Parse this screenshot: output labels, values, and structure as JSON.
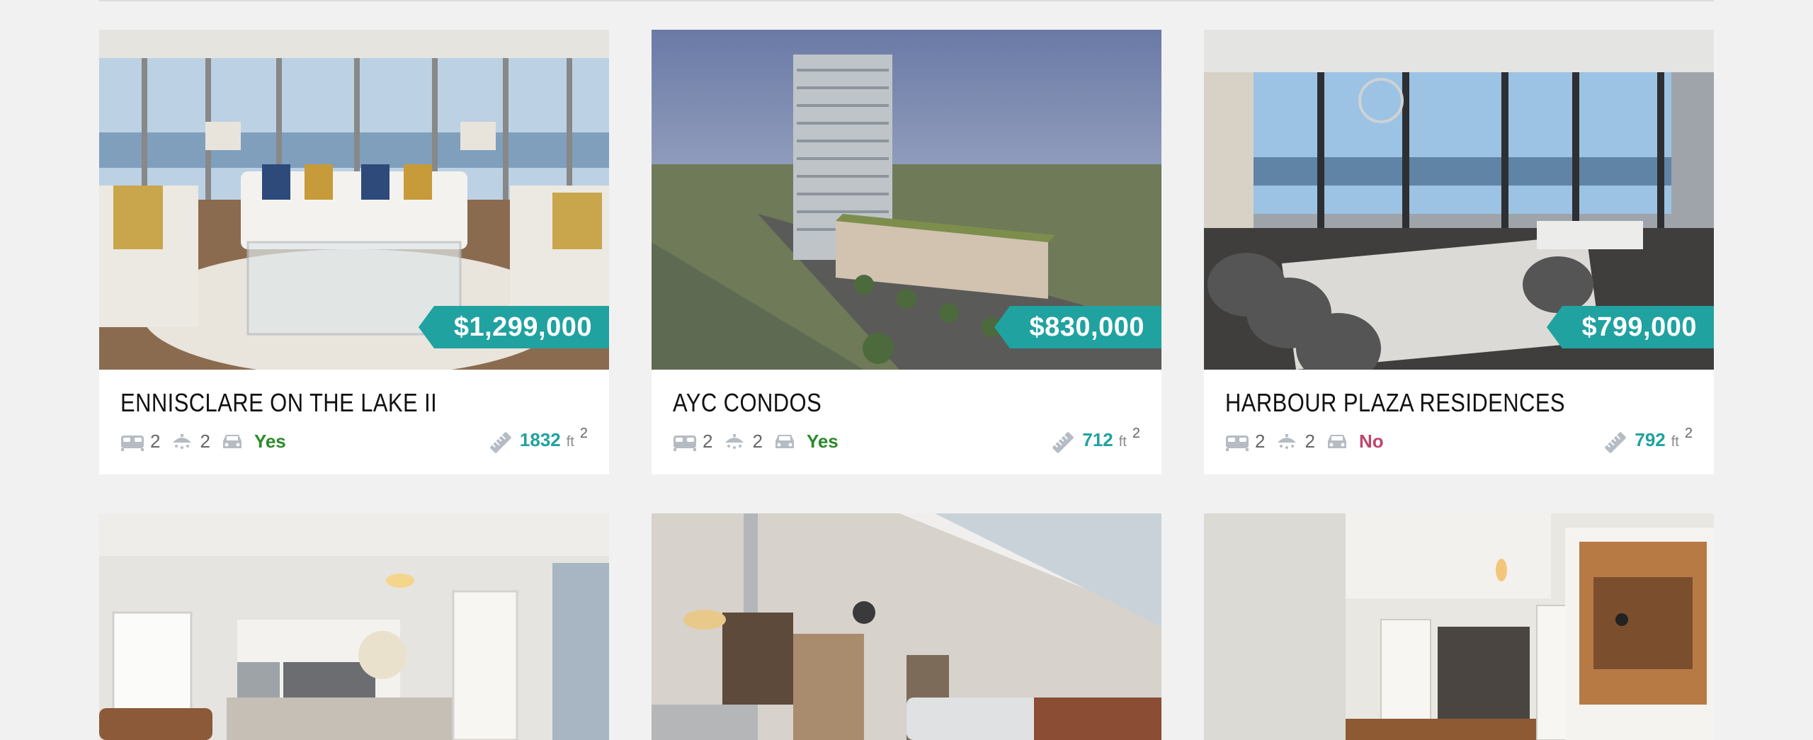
{
  "listings": [
    {
      "title": "ENNISCLARE ON THE LAKE II",
      "price": "$1,299,000",
      "beds": "2",
      "baths": "2",
      "parking": "Yes",
      "area": "1832",
      "unit": "ft",
      "sup": "2",
      "photo": "living-room-lakeview"
    },
    {
      "title": "AYC CONDOS",
      "price": "$830,000",
      "beds": "2",
      "baths": "2",
      "parking": "Yes",
      "area": "712",
      "unit": "ft",
      "sup": "2",
      "photo": "condo-tower-aerial"
    },
    {
      "title": "HARBOUR PLAZA RESIDENCES",
      "price": "$799,000",
      "beds": "2",
      "baths": "2",
      "parking": "No",
      "area": "792",
      "unit": "ft",
      "sup": "2",
      "photo": "dining-room-harbour-view"
    },
    {
      "photo": "kitchen-interior"
    },
    {
      "photo": "loft-living-room"
    },
    {
      "photo": "condo-hallway-kitchen"
    }
  ],
  "colors": {
    "accent": "#20a2a0",
    "yes": "#2b8a2b",
    "no": "#c0446a"
  },
  "icons": {
    "bed": "bed-icon",
    "bath": "bath-icon",
    "car": "car-icon",
    "ruler": "ruler-icon"
  }
}
